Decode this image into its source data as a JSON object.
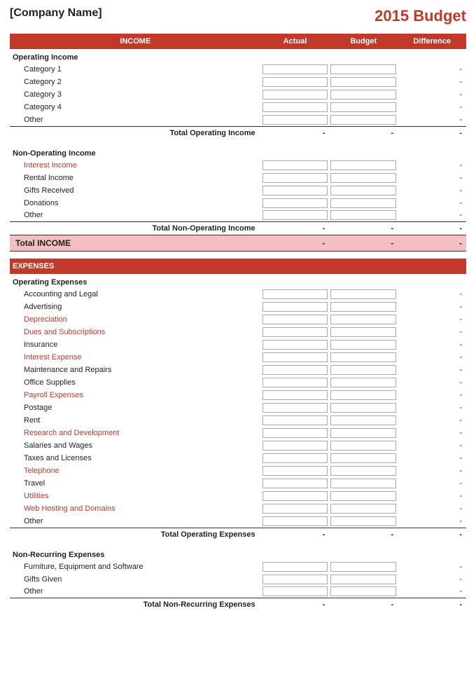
{
  "header": {
    "company": "[Company Name]",
    "title": "2015 Budget"
  },
  "income_section": {
    "label": "INCOME",
    "columns": {
      "actual": "Actual",
      "budget": "Budget",
      "difference": "Difference"
    },
    "operating_income": {
      "header": "Operating Income",
      "categories": [
        {
          "label": "Category 1",
          "red": false
        },
        {
          "label": "Category 2",
          "red": false
        },
        {
          "label": "Category 3",
          "red": false
        },
        {
          "label": "Category 4",
          "red": false
        },
        {
          "label": "Other",
          "red": false
        }
      ],
      "total_label": "Total Operating Income",
      "total_val": "-",
      "total_budget": "-",
      "total_diff": "-"
    },
    "non_operating_income": {
      "header": "Non-Operating Income",
      "categories": [
        {
          "label": "Interest Income",
          "red": true
        },
        {
          "label": "Rental Income",
          "red": false
        },
        {
          "label": "Gifts Received",
          "red": false
        },
        {
          "label": "Donations",
          "red": false
        },
        {
          "label": "Other",
          "red": false
        }
      ],
      "total_label": "Total Non-Operating Income",
      "total_val": "-",
      "total_budget": "-",
      "total_diff": "-"
    },
    "grand_total_label": "Total INCOME",
    "grand_total_actual": "-",
    "grand_total_budget": "-",
    "grand_total_diff": "-"
  },
  "expenses_section": {
    "label": "EXPENSES",
    "operating_expenses": {
      "header": "Operating Expenses",
      "categories": [
        {
          "label": "Accounting and Legal",
          "red": false
        },
        {
          "label": "Advertising",
          "red": false
        },
        {
          "label": "Depreciation",
          "red": true
        },
        {
          "label": "Dues and Subscriptions",
          "red": true
        },
        {
          "label": "Insurance",
          "red": false
        },
        {
          "label": "Interest Expense",
          "red": true
        },
        {
          "label": "Maintenance and Repairs",
          "red": false
        },
        {
          "label": "Office Supplies",
          "red": false
        },
        {
          "label": "Payroll Expenses",
          "red": true
        },
        {
          "label": "Postage",
          "red": false
        },
        {
          "label": "Rent",
          "red": false
        },
        {
          "label": "Research and Development",
          "red": true
        },
        {
          "label": "Salaries and Wages",
          "red": false
        },
        {
          "label": "Taxes and Licenses",
          "red": false
        },
        {
          "label": "Telephone",
          "red": true
        },
        {
          "label": "Travel",
          "red": false
        },
        {
          "label": "Utilities",
          "red": true
        },
        {
          "label": "Web Hosting and Domains",
          "red": true
        },
        {
          "label": "Other",
          "red": false
        }
      ],
      "total_label": "Total Operating Expenses",
      "total_val": "-",
      "total_budget": "-",
      "total_diff": "-"
    },
    "non_recurring_expenses": {
      "header": "Non-Recurring Expenses",
      "categories": [
        {
          "label": "Furniture, Equipment and Software",
          "red": false
        },
        {
          "label": "Gifts Given",
          "red": false
        },
        {
          "label": "Other",
          "red": false
        }
      ],
      "total_label": "Total Non-Recurring Expenses",
      "total_val": "-",
      "total_budget": "-",
      "total_diff": "-"
    }
  },
  "dash": "-"
}
